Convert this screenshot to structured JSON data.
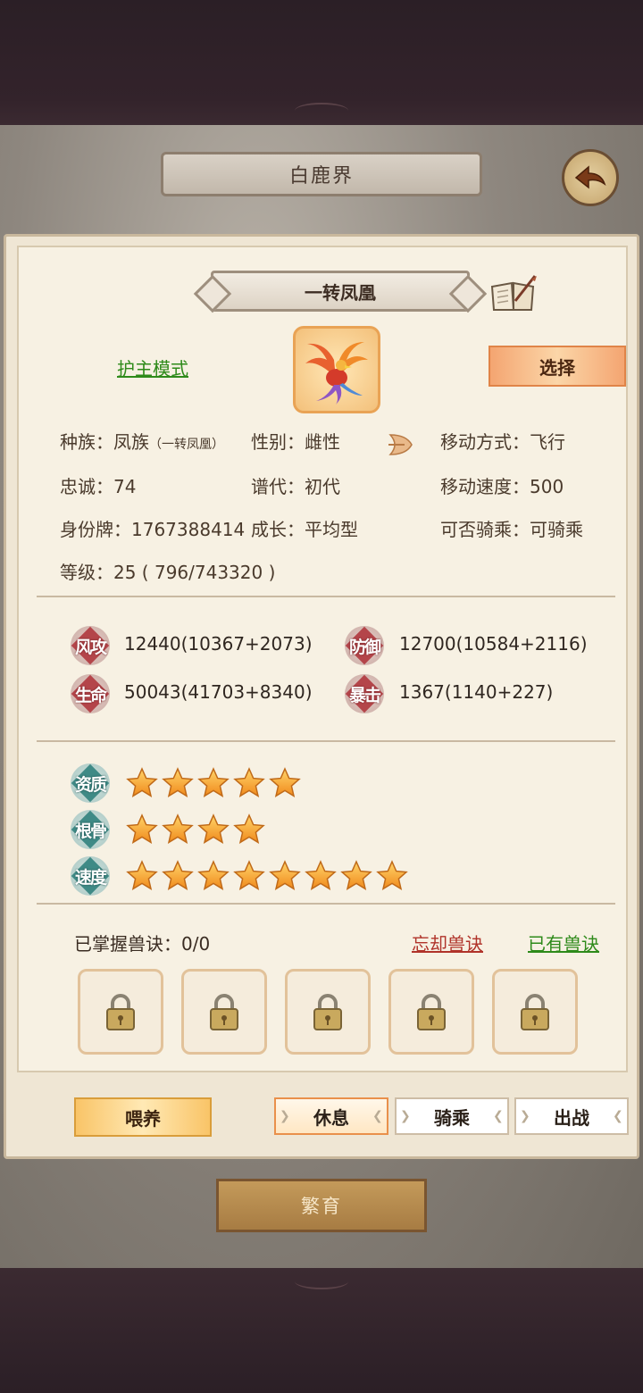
{
  "scene": {
    "title": "白鹿界"
  },
  "pet": {
    "name": "一转凤凰",
    "guard_mode_link": "护主模式",
    "select_button": "选择"
  },
  "info": {
    "race_label": "种族：",
    "race_value": "凤族",
    "race_sub": "（一转凤凰）",
    "gender": "性别：雌性",
    "move_type": "移动方式：飞行",
    "loyalty": "忠诚：74",
    "lineage": "谱代：初代",
    "move_speed": "移动速度：500",
    "id_tag": "身份牌：1767388414",
    "growth": "成长：平均型",
    "rideable": "可否骑乘：可骑乘",
    "level": "等级：25 ( 796/743320 )"
  },
  "stats": [
    {
      "label": "风攻",
      "value": "12440(10367+2073)"
    },
    {
      "label": "防御",
      "value": "12700(10584+2116)"
    },
    {
      "label": "生命",
      "value": "50043(41703+8340)"
    },
    {
      "label": "暴击",
      "value": "1367(1140+227)"
    }
  ],
  "qualities": [
    {
      "label": "资质",
      "stars": 5
    },
    {
      "label": "根骨",
      "stars": 4
    },
    {
      "label": "速度",
      "stars": 8
    }
  ],
  "skills": {
    "mastered": "已掌握兽诀：0/0",
    "forget_link": "忘却兽诀",
    "owned_link": "已有兽诀",
    "slots": 5
  },
  "actions": {
    "feed": "喂养",
    "rest": "休息",
    "ride": "骑乘",
    "battle": "出战",
    "active": "rest"
  },
  "breed_button": "繁育",
  "colors": {
    "accent_orange": "#f4a571",
    "link_green": "#2e8a1a",
    "link_red": "#b0332a",
    "stat_red": "#b4454a",
    "quality_teal": "#3f8a86"
  }
}
